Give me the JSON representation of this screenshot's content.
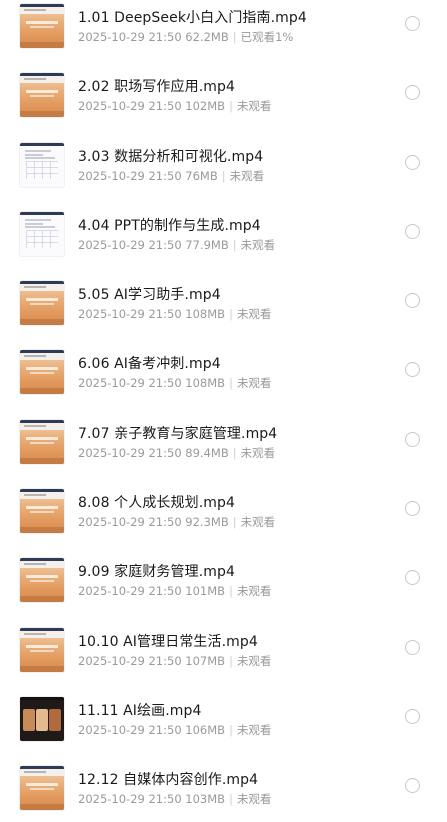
{
  "files": [
    {
      "title": "1.01 DeepSeek小白入门指南.mp4",
      "date": "2025-10-29 21:50",
      "size": "62.2MB",
      "status": "已观看1%",
      "thumb": "slide"
    },
    {
      "title": "2.02 职场写作应用.mp4",
      "date": "2025-10-29 21:50",
      "size": "102MB",
      "status": "未观看",
      "thumb": "slide"
    },
    {
      "title": "3.03 数据分析和可视化.mp4",
      "date": "2025-10-29 21:50",
      "size": "76MB",
      "status": "未观看",
      "thumb": "doc"
    },
    {
      "title": "4.04 PPT的制作与生成.mp4",
      "date": "2025-10-29 21:50",
      "size": "77.9MB",
      "status": "未观看",
      "thumb": "doc"
    },
    {
      "title": "5.05 AI学习助手.mp4",
      "date": "2025-10-29 21:50",
      "size": "108MB",
      "status": "未观看",
      "thumb": "slide"
    },
    {
      "title": "6.06 AI备考冲刺.mp4",
      "date": "2025-10-29 21:50",
      "size": "108MB",
      "status": "未观看",
      "thumb": "slide"
    },
    {
      "title": "7.07 亲子教育与家庭管理.mp4",
      "date": "2025-10-29 21:50",
      "size": "89.4MB",
      "status": "未观看",
      "thumb": "slide"
    },
    {
      "title": "8.08 个人成长规划.mp4",
      "date": "2025-10-29 21:50",
      "size": "92.3MB",
      "status": "未观看",
      "thumb": "slide"
    },
    {
      "title": "9.09 家庭财务管理.mp4",
      "date": "2025-10-29 21:50",
      "size": "101MB",
      "status": "未观看",
      "thumb": "slide"
    },
    {
      "title": "10.10 AI管理日常生活.mp4",
      "date": "2025-10-29 21:50",
      "size": "107MB",
      "status": "未观看",
      "thumb": "slide"
    },
    {
      "title": "11.11 AI绘画.mp4",
      "date": "2025-10-29 21:50",
      "size": "106MB",
      "status": "未观看",
      "thumb": "art"
    },
    {
      "title": "12.12 自媒体内容创作.mp4",
      "date": "2025-10-29 21:50",
      "size": "103MB",
      "status": "未观看",
      "thumb": "slide"
    }
  ],
  "colors": {
    "title": "#1a1a1a",
    "meta": "#9a9a9a",
    "separator": "#cfcfcf",
    "radio_border": "#c8c8c8"
  },
  "icons": {
    "select": "radio-circle-icon",
    "thumbnail": "video-thumbnail"
  }
}
